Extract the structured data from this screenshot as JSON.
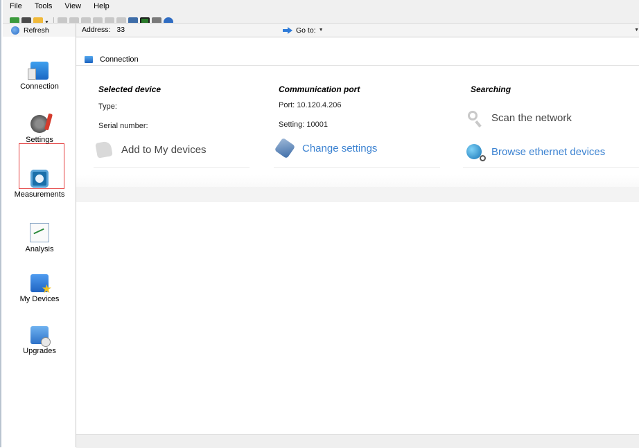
{
  "menu": [
    "File",
    "Tools",
    "View",
    "Help"
  ],
  "toolbar": {
    "icons": [
      "new-icon",
      "print-icon",
      "open-icon",
      "cut-icon",
      "save-icon",
      "save-all-icon",
      "print-preview-icon",
      "preview-icon",
      "book-icon",
      "wrench-icon",
      "terminal-icon",
      "link-icon",
      "globe-icon"
    ]
  },
  "addressbar": {
    "refresh_label": "Refresh",
    "address_label": "Address:",
    "address_value": "33",
    "goto_label": "Go to:"
  },
  "sidebar": {
    "items": [
      {
        "label": "Connection",
        "icon": "connection-icon"
      },
      {
        "label": "Settings",
        "icon": "settings-icon",
        "selected": true
      },
      {
        "label": "Measurements",
        "icon": "measurements-icon"
      },
      {
        "label": "Analysis",
        "icon": "analysis-icon"
      },
      {
        "label": "My Devices",
        "icon": "my-devices-icon"
      },
      {
        "label": "Upgrades",
        "icon": "upgrades-icon"
      }
    ]
  },
  "content": {
    "header": "Connection",
    "selected_device": {
      "title": "Selected device",
      "type_label": "Type:",
      "serial_label": "Serial number:",
      "action": "Add to My devices"
    },
    "communication_port": {
      "title": "Communication port",
      "port": "Port: 10.120.4.206",
      "setting": "Setting: 10001",
      "action": "Change settings"
    },
    "searching": {
      "title": "Searching",
      "scan": "Scan the network",
      "browse": "Browse ethernet devices"
    }
  },
  "colors": {
    "link": "#3b82d1",
    "disabled_text": "#444444",
    "selection_frame": "#e33b3b"
  }
}
